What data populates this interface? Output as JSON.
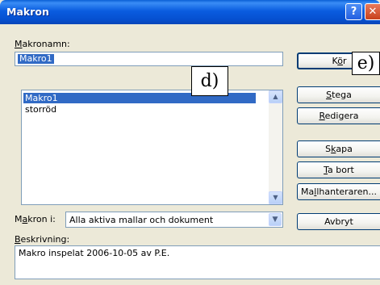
{
  "window": {
    "title": "Makron",
    "help_glyph": "?",
    "close_glyph": "✕"
  },
  "macro_name": {
    "label_key": "M",
    "label_rest": "akronamn:",
    "value": "Makro1"
  },
  "macro_list": {
    "items": [
      "Makro1",
      "storröd"
    ],
    "selected_index": 0
  },
  "buttons": {
    "run": {
      "pre": "K",
      "key": "ö",
      "post": "r"
    },
    "step": {
      "pre": "",
      "key": "S",
      "post": "tega"
    },
    "edit": {
      "pre": "",
      "key": "R",
      "post": "edigera"
    },
    "create": {
      "pre": "S",
      "key": "k",
      "post": "apa"
    },
    "delete": {
      "pre": "",
      "key": "T",
      "post": "a bort"
    },
    "organizer": {
      "pre": "Ma",
      "key": "l",
      "post": "lhanteraren..."
    },
    "cancel": {
      "pre": "",
      "key": "",
      "post": "Avbryt"
    }
  },
  "macros_in": {
    "label_pre": "M",
    "label_key": "a",
    "label_post": "kron i:",
    "value": "Alla aktiva mallar och dokument"
  },
  "description": {
    "label_key": "B",
    "label_rest": "eskrivning:",
    "value": "Makro inspelat 2006-10-05 av P.E."
  },
  "callouts": {
    "d": "d)",
    "e": "e)"
  },
  "icons": {
    "scroll_up": "chevron-up-icon",
    "scroll_down": "chevron-down-icon",
    "combo_arrow": "chevron-down-icon"
  }
}
